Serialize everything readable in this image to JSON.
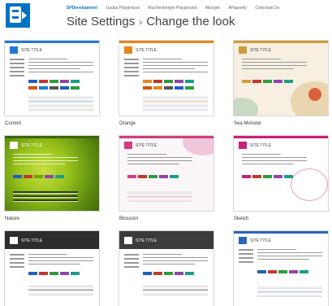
{
  "topnav": {
    "items": [
      "SPDevelopment",
      "Gudas Playground",
      "Muchlenberger Playground",
      "Allorgeti",
      "APapsetty",
      "Corporate Do"
    ]
  },
  "page": {
    "section": "Site Settings",
    "separator": "›",
    "title": "Change the look"
  },
  "thumb": {
    "site_title": "SITE TITLE"
  },
  "looks": [
    {
      "name": "Current",
      "accent": "#1e7bd4"
    },
    {
      "name": "Orange",
      "accent": "#e8861c"
    },
    {
      "name": "Sea Monster",
      "accent": "#d39b3a"
    },
    {
      "name": "Nature",
      "accent": "#6f9e12"
    },
    {
      "name": "Blossom",
      "accent": "#d43b82"
    },
    {
      "name": "Sketch",
      "accent": "#c9207a"
    },
    {
      "name": "",
      "accent": "#2d2d2d"
    },
    {
      "name": "",
      "accent": "#3b3b3b"
    },
    {
      "name": "",
      "accent": "#2a66b8"
    }
  ],
  "colors": {
    "brand": "#0072c6",
    "swatches": [
      "#1f5fbf",
      "#c0392b",
      "#2e9b3b",
      "#8e44ad",
      "#16a085",
      "#d35400"
    ]
  }
}
